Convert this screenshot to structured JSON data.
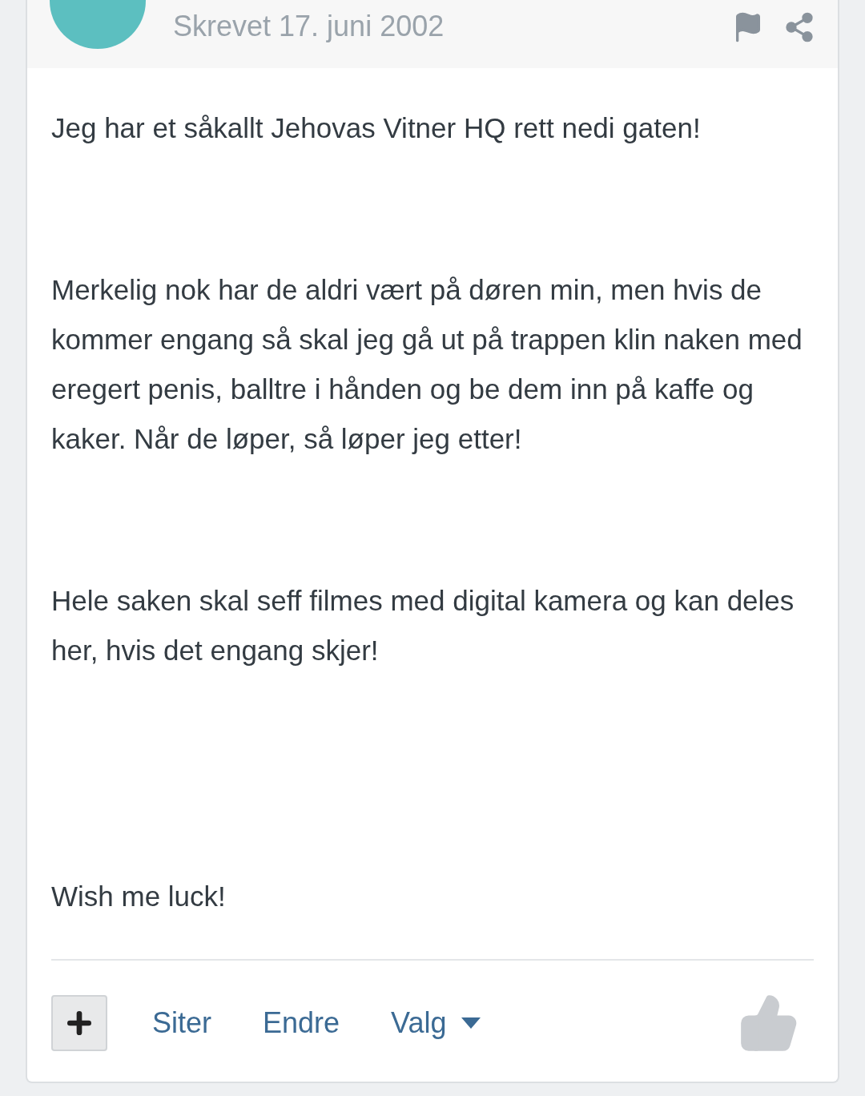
{
  "post": {
    "date": "Skrevet 17. juni 2002",
    "paragraphs": [
      "Jeg har et såkallt Jehovas Vitner HQ rett nedi gaten!",
      "Merkelig nok har de aldri vært på døren min, men hvis de kommer engang så skal jeg gå ut på trappen klin naken med eregert penis, balltre i hånden og be dem inn på kaffe og kaker. Når de løper, så løper jeg etter!",
      "Hele saken skal seff filmes med digital kamera og kan deles her, hvis det engang skjer!",
      "Wish me luck!"
    ],
    "actions": [
      {
        "label": "Siter",
        "kind": "link"
      },
      {
        "label": "Endre",
        "kind": "link"
      },
      {
        "label": "Valg",
        "kind": "menu"
      }
    ]
  }
}
